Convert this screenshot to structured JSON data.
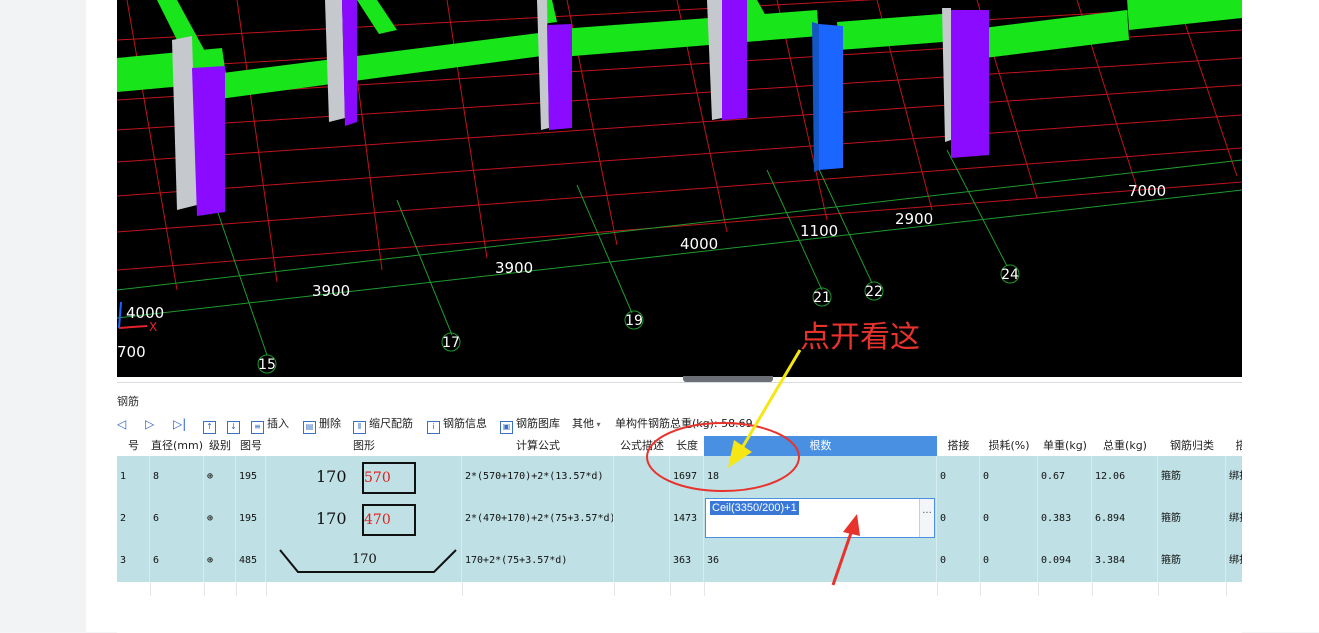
{
  "viewport": {
    "dimensions": [
      {
        "text": "3900"
      },
      {
        "text": "3900"
      },
      {
        "text": "4000"
      },
      {
        "text": "1100"
      },
      {
        "text": "2900"
      },
      {
        "text": "7000"
      },
      {
        "text": "4000"
      },
      {
        "text": "700"
      }
    ],
    "axis_numbers": [
      {
        "text": "15"
      },
      {
        "text": "17"
      },
      {
        "text": "19"
      },
      {
        "text": "21"
      },
      {
        "text": "22"
      },
      {
        "text": "24"
      }
    ],
    "axis_x_label": "X"
  },
  "panel": {
    "title": "钢筋"
  },
  "toolbar": {
    "insert": "插入",
    "delete": "删除",
    "scale_rebar": "缩尺配筋",
    "rebar_info": "钢筋信息",
    "rebar_library": "钢筋图库",
    "other": "其他",
    "total_weight_label": "单构件钢筋总重(kg): 58.69"
  },
  "grid": {
    "columns": [
      "号",
      "直径(mm)",
      "级别",
      "图号",
      "图形",
      "计算公式",
      "公式描述",
      "长度",
      "根数",
      "搭接",
      "损耗(%)",
      "单重(kg)",
      "总重(kg)",
      "钢筋归类",
      "搭"
    ],
    "rows": [
      {
        "no": "1",
        "dia": "8",
        "grade": "⊕",
        "fig": "195",
        "shape_a": "170",
        "shape_b": "570",
        "formula": "2*(570+170)+2*(13.57*d)",
        "desc": "",
        "length": "1697",
        "count": "18",
        "lap": "0",
        "loss": "0",
        "unit": "0.67",
        "total": "12.06",
        "type": "箍筋",
        "bind": "绑扎"
      },
      {
        "no": "2",
        "dia": "6",
        "grade": "⊕",
        "fig": "195",
        "shape_a": "170",
        "shape_b": "470",
        "formula": "2*(470+170)+2*(75+3.57*d)",
        "desc": "",
        "length": "1473",
        "count": "Ceil(3350/200)+1",
        "lap": "0",
        "loss": "0",
        "unit": "0.383",
        "total": "6.894",
        "type": "箍筋",
        "bind": "绑扎"
      },
      {
        "no": "3",
        "dia": "6",
        "grade": "⊕",
        "fig": "485",
        "shape_a": "170",
        "shape_b": "",
        "formula": "170+2*(75+3.57*d)",
        "desc": "",
        "length": "363",
        "count": "36",
        "lap": "0",
        "loss": "0",
        "unit": "0.094",
        "total": "3.384",
        "type": "箍筋",
        "bind": "绑扎"
      }
    ]
  },
  "annotation": {
    "text": "点开看这",
    "color": "#e8322c",
    "arrow_color": "#f5e614"
  }
}
